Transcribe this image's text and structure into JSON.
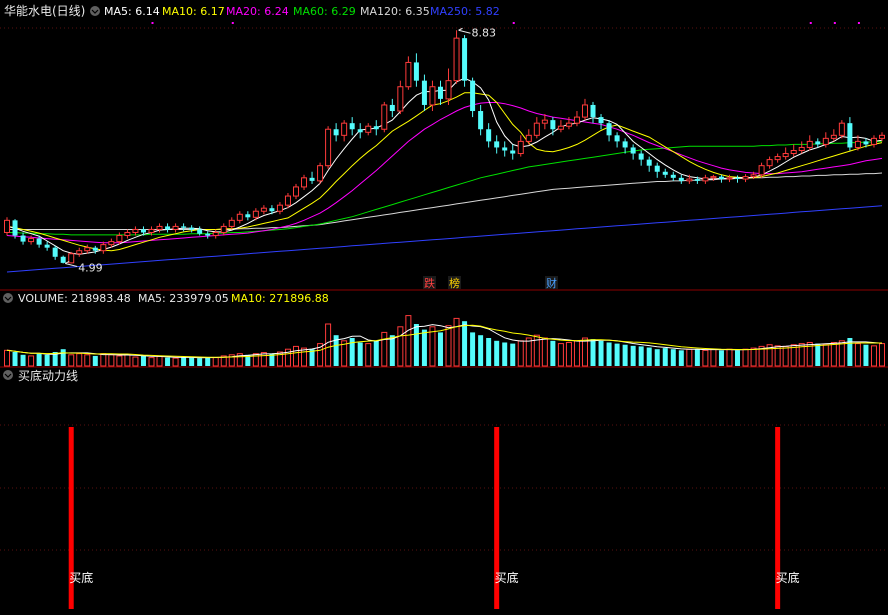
{
  "main_panel": {
    "stock_name": "华能水电(日线)",
    "ma5": "MA5: 6.14",
    "ma10": "MA10: 6.17",
    "ma20": "MA20: 6.24",
    "ma60": "MA60: 6.29",
    "ma120": "MA120: 6.35",
    "ma250": "MA250: 5.82",
    "high_label": "8.83",
    "low_label": "4.99",
    "badges": [
      {
        "text": "跌",
        "color": "#ff4040"
      },
      {
        "text": "榜",
        "color": "#ffd200"
      },
      {
        "text": "财",
        "color": "#4aa0ff"
      }
    ]
  },
  "volume_panel": {
    "volume": "VOLUME: 218983.48",
    "ma5": "MA5: 233979.05",
    "ma10": "MA10: 271896.88"
  },
  "indicator_panel": {
    "title": "买底动力线",
    "signal_label": "买底"
  },
  "colors": {
    "up": "#ff3b3b",
    "down": "#54fcfc",
    "ma5": "#ffffff",
    "ma10": "#ffff00",
    "ma20": "#ff00ff",
    "ma60": "#00e000",
    "ma120": "#d8d8d8",
    "ma250": "#3040ff",
    "signal": "#ff0000",
    "divider": "#8b0000"
  },
  "chart_data": {
    "type": "candlestick",
    "price_high": 8.83,
    "price_low": 4.99,
    "candles": [
      [
        5.5,
        5.7,
        5.45,
        5.75
      ],
      [
        5.7,
        5.45,
        5.4,
        5.72
      ],
      [
        5.45,
        5.35,
        5.3,
        5.5
      ],
      [
        5.35,
        5.4,
        5.3,
        5.45
      ],
      [
        5.4,
        5.3,
        5.25,
        5.45
      ],
      [
        5.3,
        5.25,
        5.2,
        5.35
      ],
      [
        5.25,
        5.1,
        5.05,
        5.28
      ],
      [
        5.1,
        5.0,
        4.99,
        5.12
      ],
      [
        5.0,
        5.15,
        4.99,
        5.18
      ],
      [
        5.15,
        5.2,
        5.1,
        5.25
      ],
      [
        5.2,
        5.25,
        5.15,
        5.3
      ],
      [
        5.25,
        5.2,
        5.15,
        5.28
      ],
      [
        5.2,
        5.3,
        5.15,
        5.35
      ],
      [
        5.3,
        5.35,
        5.25,
        5.4
      ],
      [
        5.35,
        5.45,
        5.3,
        5.5
      ],
      [
        5.45,
        5.5,
        5.4,
        5.55
      ],
      [
        5.5,
        5.55,
        5.45,
        5.6
      ],
      [
        5.55,
        5.5,
        5.45,
        5.6
      ],
      [
        5.5,
        5.55,
        5.45,
        5.6
      ],
      [
        5.55,
        5.6,
        5.5,
        5.65
      ],
      [
        5.6,
        5.55,
        5.5,
        5.65
      ],
      [
        5.55,
        5.6,
        5.5,
        5.65
      ],
      [
        5.6,
        5.58,
        5.52,
        5.65
      ],
      [
        5.58,
        5.55,
        5.5,
        5.62
      ],
      [
        5.55,
        5.48,
        5.45,
        5.6
      ],
      [
        5.48,
        5.45,
        5.4,
        5.52
      ],
      [
        5.45,
        5.5,
        5.4,
        5.55
      ],
      [
        5.5,
        5.6,
        5.45,
        5.65
      ],
      [
        5.6,
        5.7,
        5.55,
        5.75
      ],
      [
        5.7,
        5.8,
        5.65,
        5.85
      ],
      [
        5.8,
        5.75,
        5.7,
        5.85
      ],
      [
        5.75,
        5.85,
        5.7,
        5.9
      ],
      [
        5.85,
        5.9,
        5.8,
        5.95
      ],
      [
        5.9,
        5.85,
        5.8,
        5.95
      ],
      [
        5.85,
        5.95,
        5.8,
        6.0
      ],
      [
        5.95,
        6.1,
        5.9,
        6.15
      ],
      [
        6.1,
        6.25,
        6.05,
        6.3
      ],
      [
        6.25,
        6.4,
        6.2,
        6.45
      ],
      [
        6.4,
        6.35,
        6.3,
        6.5
      ],
      [
        6.35,
        6.6,
        6.3,
        6.65
      ],
      [
        6.6,
        7.2,
        6.55,
        7.25
      ],
      [
        7.2,
        7.1,
        7.0,
        7.3
      ],
      [
        7.1,
        7.3,
        7.0,
        7.35
      ],
      [
        7.3,
        7.2,
        7.1,
        7.4
      ],
      [
        7.2,
        7.15,
        7.05,
        7.3
      ],
      [
        7.15,
        7.25,
        7.1,
        7.3
      ],
      [
        7.25,
        7.2,
        7.1,
        7.35
      ],
      [
        7.2,
        7.6,
        7.15,
        7.65
      ],
      [
        7.6,
        7.5,
        7.4,
        7.7
      ],
      [
        7.5,
        7.9,
        7.45,
        8.0
      ],
      [
        7.9,
        8.3,
        7.85,
        8.4
      ],
      [
        8.3,
        8.0,
        7.9,
        8.45
      ],
      [
        8.0,
        7.6,
        7.5,
        8.1
      ],
      [
        7.6,
        7.9,
        7.5,
        8.0
      ],
      [
        7.9,
        7.7,
        7.6,
        8.0
      ],
      [
        7.7,
        8.0,
        7.6,
        8.2
      ],
      [
        8.0,
        8.7,
        7.95,
        8.83
      ],
      [
        8.7,
        8.0,
        7.9,
        8.75
      ],
      [
        8.0,
        7.5,
        7.4,
        8.05
      ],
      [
        7.5,
        7.2,
        7.1,
        7.6
      ],
      [
        7.2,
        7.0,
        6.9,
        7.3
      ],
      [
        7.0,
        6.9,
        6.8,
        7.1
      ],
      [
        6.9,
        6.85,
        6.75,
        7.0
      ],
      [
        6.85,
        6.8,
        6.7,
        6.95
      ],
      [
        6.8,
        7.0,
        6.75,
        7.1
      ],
      [
        7.0,
        7.1,
        6.95,
        7.2
      ],
      [
        7.1,
        7.3,
        7.05,
        7.4
      ],
      [
        7.3,
        7.35,
        7.2,
        7.45
      ],
      [
        7.35,
        7.2,
        7.1,
        7.4
      ],
      [
        7.2,
        7.25,
        7.15,
        7.35
      ],
      [
        7.25,
        7.3,
        7.2,
        7.4
      ],
      [
        7.3,
        7.4,
        7.25,
        7.5
      ],
      [
        7.4,
        7.6,
        7.35,
        7.7
      ],
      [
        7.6,
        7.4,
        7.3,
        7.65
      ],
      [
        7.4,
        7.3,
        7.2,
        7.45
      ],
      [
        7.3,
        7.1,
        7.0,
        7.35
      ],
      [
        7.1,
        7.0,
        6.9,
        7.15
      ],
      [
        7.0,
        6.9,
        6.8,
        7.05
      ],
      [
        6.9,
        6.8,
        6.7,
        6.95
      ],
      [
        6.8,
        6.7,
        6.6,
        6.85
      ],
      [
        6.7,
        6.6,
        6.5,
        6.75
      ],
      [
        6.6,
        6.5,
        6.4,
        6.65
      ],
      [
        6.5,
        6.45,
        6.4,
        6.55
      ],
      [
        6.45,
        6.4,
        6.35,
        6.5
      ],
      [
        6.4,
        6.35,
        6.3,
        6.45
      ],
      [
        6.35,
        6.38,
        6.3,
        6.45
      ],
      [
        6.38,
        6.35,
        6.3,
        6.42
      ],
      [
        6.35,
        6.4,
        6.3,
        6.45
      ],
      [
        6.4,
        6.42,
        6.35,
        6.45
      ],
      [
        6.42,
        6.38,
        6.32,
        6.45
      ],
      [
        6.38,
        6.4,
        6.33,
        6.45
      ],
      [
        6.4,
        6.38,
        6.32,
        6.44
      ],
      [
        6.38,
        6.42,
        6.33,
        6.46
      ],
      [
        6.42,
        6.45,
        6.38,
        6.5
      ],
      [
        6.45,
        6.6,
        6.4,
        6.65
      ],
      [
        6.6,
        6.7,
        6.55,
        6.75
      ],
      [
        6.7,
        6.75,
        6.65,
        6.8
      ],
      [
        6.75,
        6.8,
        6.7,
        6.9
      ],
      [
        6.8,
        6.85,
        6.75,
        6.95
      ],
      [
        6.85,
        6.9,
        6.8,
        7.0
      ],
      [
        6.9,
        7.0,
        6.85,
        7.1
      ],
      [
        7.0,
        6.95,
        6.9,
        7.05
      ],
      [
        6.95,
        7.05,
        6.9,
        7.15
      ],
      [
        7.05,
        7.1,
        7.0,
        7.2
      ],
      [
        7.1,
        7.3,
        7.05,
        7.35
      ],
      [
        7.3,
        6.9,
        6.85,
        7.4
      ],
      [
        6.9,
        7.0,
        6.85,
        7.1
      ],
      [
        7.0,
        6.95,
        6.9,
        7.05
      ],
      [
        6.95,
        7.05,
        6.9,
        7.1
      ],
      [
        7.05,
        7.1,
        7.0,
        7.15
      ]
    ],
    "volume": [
      0.28,
      0.25,
      0.2,
      0.18,
      0.22,
      0.2,
      0.25,
      0.3,
      0.2,
      0.22,
      0.2,
      0.18,
      0.22,
      0.2,
      0.18,
      0.2,
      0.16,
      0.18,
      0.15,
      0.17,
      0.15,
      0.14,
      0.16,
      0.15,
      0.14,
      0.16,
      0.15,
      0.18,
      0.2,
      0.22,
      0.2,
      0.22,
      0.24,
      0.22,
      0.25,
      0.3,
      0.35,
      0.32,
      0.3,
      0.4,
      0.75,
      0.55,
      0.45,
      0.5,
      0.42,
      0.4,
      0.45,
      0.6,
      0.55,
      0.7,
      0.9,
      0.75,
      0.65,
      0.7,
      0.6,
      0.72,
      0.85,
      0.8,
      0.6,
      0.55,
      0.5,
      0.45,
      0.42,
      0.4,
      0.45,
      0.5,
      0.55,
      0.5,
      0.45,
      0.4,
      0.42,
      0.45,
      0.5,
      0.48,
      0.45,
      0.42,
      0.4,
      0.38,
      0.36,
      0.35,
      0.33,
      0.3,
      0.32,
      0.3,
      0.28,
      0.3,
      0.3,
      0.28,
      0.3,
      0.28,
      0.3,
      0.28,
      0.3,
      0.32,
      0.35,
      0.38,
      0.36,
      0.35,
      0.38,
      0.4,
      0.42,
      0.4,
      0.38,
      0.42,
      0.45,
      0.5,
      0.4,
      0.38,
      0.36,
      0.4
    ],
    "ma5": [
      5.6,
      5.57,
      5.52,
      5.48,
      5.44,
      5.36,
      5.28,
      5.2,
      5.16,
      5.14,
      5.16,
      5.18,
      5.22,
      5.26,
      5.31,
      5.37,
      5.42,
      5.47,
      5.5,
      5.54,
      5.55,
      5.56,
      5.57,
      5.57,
      5.56,
      5.53,
      5.51,
      5.51,
      5.54,
      5.59,
      5.65,
      5.72,
      5.78,
      5.82,
      5.86,
      5.91,
      5.99,
      6.09,
      6.19,
      6.31,
      6.52,
      6.71,
      6.88,
      7.04,
      7.19,
      7.2,
      7.22,
      7.28,
      7.35,
      7.49,
      7.64,
      7.76,
      7.82,
      7.82,
      7.84,
      7.84,
      7.98,
      8.04,
      7.98,
      7.88,
      7.68,
      7.32,
      7.09,
      6.95,
      6.91,
      6.93,
      6.99,
      7.07,
      7.15,
      7.24,
      7.28,
      7.3,
      7.35,
      7.39,
      7.37,
      7.34,
      7.28,
      7.14,
      7.0,
      6.9,
      6.8,
      6.7,
      6.61,
      6.53,
      6.46,
      6.42,
      6.4,
      6.38,
      6.38,
      6.39,
      6.39,
      6.4,
      6.4,
      6.41,
      6.45,
      6.51,
      6.58,
      6.66,
      6.74,
      6.8,
      6.86,
      6.9,
      6.95,
      7.0,
      7.08,
      7.06,
      7.07,
      7.05,
      7.0,
      7.02
    ],
    "ma10": [
      5.6,
      5.58,
      5.55,
      5.52,
      5.49,
      5.45,
      5.41,
      5.37,
      5.33,
      5.29,
      5.26,
      5.23,
      5.21,
      5.2,
      5.22,
      5.26,
      5.3,
      5.34,
      5.38,
      5.42,
      5.45,
      5.48,
      5.51,
      5.53,
      5.55,
      5.55,
      5.55,
      5.56,
      5.56,
      5.57,
      5.59,
      5.62,
      5.65,
      5.68,
      5.71,
      5.74,
      5.82,
      5.9,
      5.98,
      6.07,
      6.2,
      6.34,
      6.47,
      6.6,
      6.72,
      6.83,
      6.93,
      7.05,
      7.17,
      7.25,
      7.33,
      7.42,
      7.51,
      7.6,
      7.62,
      7.67,
      7.73,
      7.8,
      7.8,
      7.78,
      7.76,
      7.64,
      7.46,
      7.28,
      7.15,
      6.97,
      6.87,
      6.84,
      6.83,
      6.86,
      6.9,
      6.95,
      7.02,
      7.1,
      7.18,
      7.24,
      7.27,
      7.22,
      7.17,
      7.12,
      7.07,
      6.99,
      6.91,
      6.83,
      6.75,
      6.67,
      6.6,
      6.54,
      6.49,
      6.45,
      6.42,
      6.41,
      6.4,
      6.4,
      6.42,
      6.45,
      6.48,
      6.52,
      6.56,
      6.6,
      6.64,
      6.68,
      6.72,
      6.76,
      6.8,
      6.84,
      6.88,
      6.92,
      6.95,
      6.98
    ],
    "ma20": [
      5.45,
      5.44,
      5.43,
      5.42,
      5.41,
      5.4,
      5.39,
      5.38,
      5.37,
      5.36,
      5.35,
      5.34,
      5.33,
      5.33,
      5.33,
      5.34,
      5.35,
      5.36,
      5.37,
      5.38,
      5.39,
      5.4,
      5.41,
      5.42,
      5.43,
      5.44,
      5.45,
      5.46,
      5.47,
      5.48,
      5.49,
      5.51,
      5.53,
      5.55,
      5.58,
      5.61,
      5.65,
      5.7,
      5.76,
      5.82,
      5.9,
      5.99,
      6.09,
      6.19,
      6.3,
      6.41,
      6.52,
      6.64,
      6.76,
      6.88,
      7.0,
      7.1,
      7.2,
      7.28,
      7.36,
      7.43,
      7.5,
      7.56,
      7.6,
      7.63,
      7.64,
      7.64,
      7.62,
      7.59,
      7.55,
      7.5,
      7.46,
      7.43,
      7.4,
      7.38,
      7.36,
      7.34,
      7.32,
      7.3,
      7.28,
      7.24,
      7.2,
      7.15,
      7.1,
      7.04,
      6.98,
      6.93,
      6.88,
      6.83,
      6.78,
      6.73,
      6.68,
      6.64,
      6.6,
      6.56,
      6.53,
      6.51,
      6.49,
      6.48,
      6.47,
      6.47,
      6.47,
      6.48,
      6.49,
      6.5,
      6.52,
      6.54,
      6.56,
      6.58,
      6.6,
      6.62,
      6.65,
      6.68,
      6.7,
      6.72
    ],
    "ma60": [
      5.5,
      5.5,
      5.49,
      5.49,
      5.48,
      5.48,
      5.47,
      5.47,
      5.46,
      5.46,
      5.46,
      5.46,
      5.46,
      5.46,
      5.46,
      5.46,
      5.46,
      5.46,
      5.47,
      5.47,
      5.47,
      5.47,
      5.47,
      5.48,
      5.48,
      5.48,
      5.49,
      5.49,
      5.5,
      5.5,
      5.51,
      5.52,
      5.53,
      5.54,
      5.55,
      5.56,
      5.58,
      5.6,
      5.62,
      5.64,
      5.67,
      5.7,
      5.73,
      5.76,
      5.8,
      5.84,
      5.88,
      5.92,
      5.96,
      6.0,
      6.04,
      6.08,
      6.12,
      6.16,
      6.2,
      6.24,
      6.28,
      6.32,
      6.36,
      6.4,
      6.43,
      6.46,
      6.49,
      6.52,
      6.55,
      6.58,
      6.6,
      6.62,
      6.64,
      6.66,
      6.68,
      6.7,
      6.72,
      6.74,
      6.76,
      6.78,
      6.8,
      6.82,
      6.84,
      6.86,
      6.87,
      6.88,
      6.89,
      6.9,
      6.91,
      6.92,
      6.92,
      6.92,
      6.92,
      6.92,
      6.92,
      6.92,
      6.92,
      6.92,
      6.93,
      6.93,
      6.94,
      6.94,
      6.95,
      6.95,
      6.95,
      6.96,
      6.96,
      6.97,
      6.97,
      6.98,
      6.98,
      6.99,
      6.99,
      7.0
    ],
    "ma120": [
      5.55,
      5.55,
      5.55,
      5.55,
      5.55,
      5.55,
      5.55,
      5.55,
      5.55,
      5.55,
      5.55,
      5.55,
      5.55,
      5.55,
      5.55,
      5.55,
      5.55,
      5.55,
      5.55,
      5.55,
      5.55,
      5.55,
      5.55,
      5.55,
      5.55,
      5.55,
      5.55,
      5.55,
      5.55,
      5.56,
      5.56,
      5.57,
      5.57,
      5.58,
      5.58,
      5.59,
      5.6,
      5.61,
      5.62,
      5.63,
      5.65,
      5.67,
      5.69,
      5.71,
      5.73,
      5.75,
      5.77,
      5.79,
      5.81,
      5.83,
      5.85,
      5.87,
      5.89,
      5.91,
      5.93,
      5.95,
      5.97,
      5.99,
      6.01,
      6.03,
      6.05,
      6.07,
      6.09,
      6.11,
      6.13,
      6.15,
      6.17,
      6.19,
      6.21,
      6.22,
      6.23,
      6.24,
      6.25,
      6.26,
      6.27,
      6.28,
      6.29,
      6.3,
      6.31,
      6.32,
      6.33,
      6.34,
      6.34,
      6.35,
      6.35,
      6.36,
      6.36,
      6.37,
      6.37,
      6.38,
      6.38,
      6.39,
      6.39,
      6.4,
      6.4,
      6.41,
      6.41,
      6.42,
      6.42,
      6.43,
      6.43,
      6.44,
      6.44,
      6.45,
      6.45,
      6.46,
      6.46,
      6.47,
      6.47,
      6.48
    ],
    "ma250": [
      4.85,
      4.86,
      4.87,
      4.88,
      4.89,
      4.9,
      4.91,
      4.92,
      4.93,
      4.94,
      4.95,
      4.96,
      4.97,
      4.98,
      4.99,
      5.0,
      5.01,
      5.02,
      5.03,
      5.04,
      5.05,
      5.06,
      5.07,
      5.08,
      5.09,
      5.1,
      5.11,
      5.12,
      5.13,
      5.14,
      5.15,
      5.16,
      5.17,
      5.18,
      5.19,
      5.2,
      5.21,
      5.22,
      5.23,
      5.24,
      5.25,
      5.26,
      5.27,
      5.28,
      5.29,
      5.3,
      5.31,
      5.32,
      5.33,
      5.34,
      5.35,
      5.36,
      5.37,
      5.38,
      5.39,
      5.4,
      5.41,
      5.42,
      5.43,
      5.44,
      5.45,
      5.46,
      5.47,
      5.48,
      5.49,
      5.5,
      5.51,
      5.52,
      5.53,
      5.54,
      5.55,
      5.56,
      5.57,
      5.58,
      5.59,
      5.6,
      5.61,
      5.62,
      5.63,
      5.64,
      5.65,
      5.66,
      5.67,
      5.68,
      5.69,
      5.7,
      5.71,
      5.72,
      5.73,
      5.74,
      5.75,
      5.76,
      5.77,
      5.78,
      5.79,
      5.8,
      5.81,
      5.82,
      5.83,
      5.84,
      5.85,
      5.86,
      5.87,
      5.88,
      5.89,
      5.9,
      5.91,
      5.92,
      5.93,
      5.94
    ],
    "signals": [
      8,
      61,
      96
    ]
  }
}
